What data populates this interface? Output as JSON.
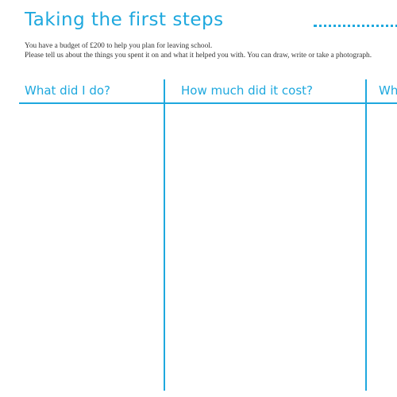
{
  "header": {
    "title": "Taking the first steps"
  },
  "intro": {
    "line1": "You have a budget of £200 to help you plan for leaving school.",
    "line2": "Please tell us about the things you spent it on and what it helped you with. You can draw, write or take a photograph."
  },
  "table": {
    "columns": [
      {
        "label": "What did I do?"
      },
      {
        "label": "How much did it cost?"
      },
      {
        "label": "Wh"
      }
    ]
  },
  "colors": {
    "accent": "#1ea8de",
    "body_text": "#333333"
  }
}
